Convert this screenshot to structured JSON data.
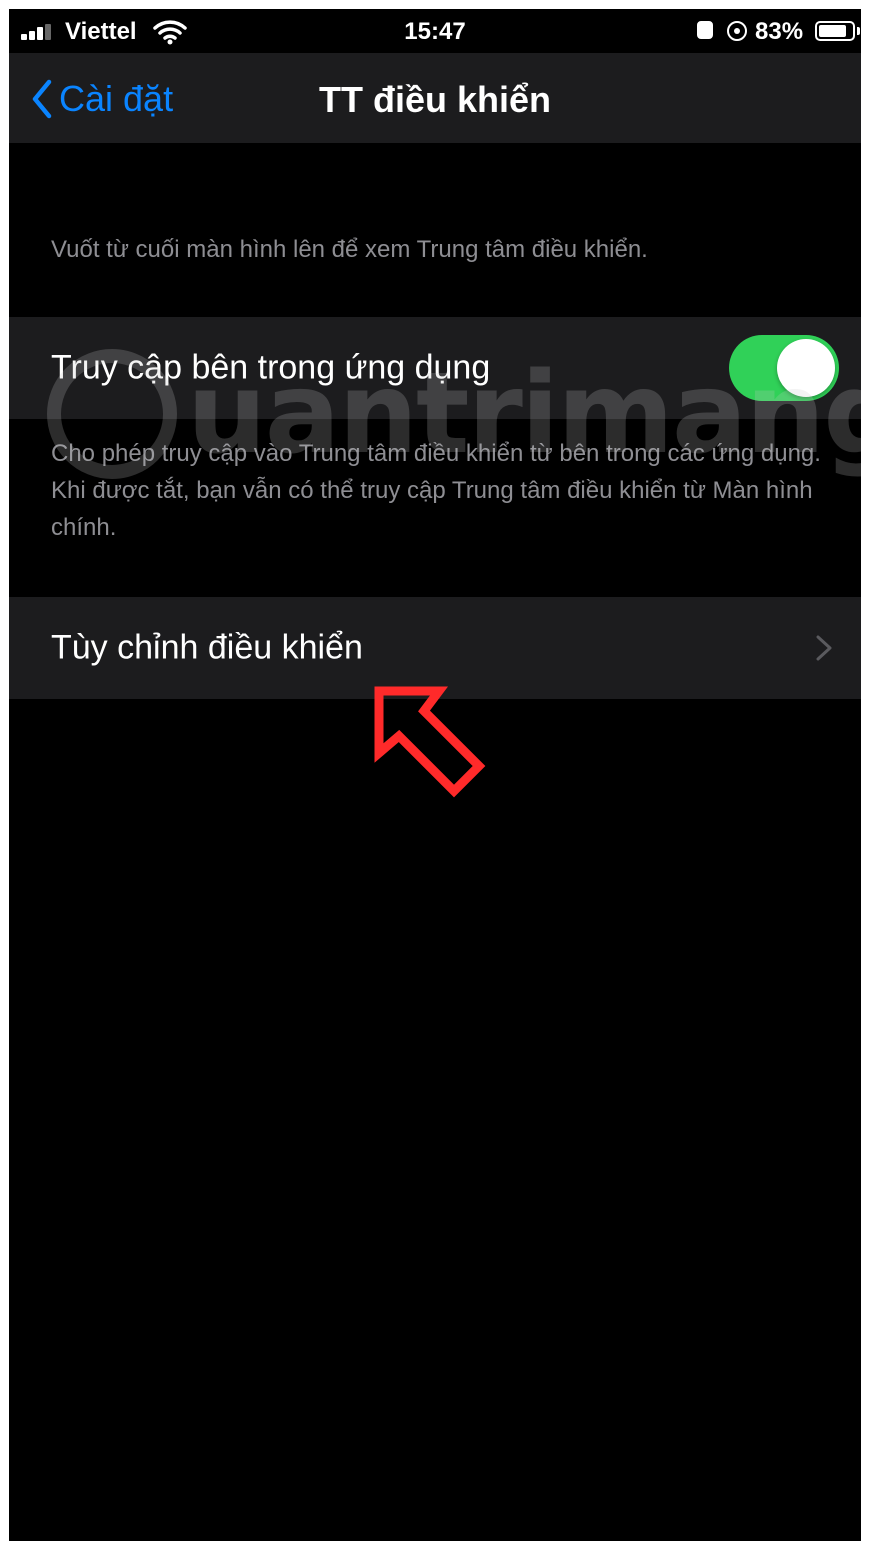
{
  "status_bar": {
    "carrier": "Viettel",
    "time": "15:47",
    "battery_percent": "83%",
    "battery_level": 0.83,
    "icons": [
      "signal-icon",
      "wifi-icon",
      "alarm-icon",
      "rotation-lock-icon",
      "battery-icon"
    ]
  },
  "nav": {
    "back_label": "Cài đặt",
    "title": "TT điều khiển"
  },
  "header_note": "Vuốt từ cuối màn hình lên để xem Trung tâm điều khiển.",
  "access_row": {
    "label": "Truy cập bên trong ứng dụng",
    "toggle_on": true
  },
  "access_footer": "Cho phép truy cập vào Trung tâm điều khiển từ bên trong các ứng dụng. Khi được tắt, bạn vẫn có thể truy cập Trung tâm điều khiển từ Màn hình chính.",
  "customize_row": {
    "label": "Tùy chỉnh điều khiển"
  },
  "watermark": "uantrimang",
  "colors": {
    "background": "#000000",
    "cell": "#1c1c1e",
    "accent": "#0a84ff",
    "toggle_on": "#30d158",
    "secondary_text": "#8e8e93",
    "annotation_arrow": "#ff2a2a"
  }
}
